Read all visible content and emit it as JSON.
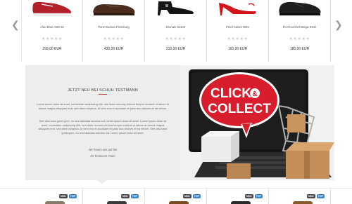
{
  "carousel": {
    "prev_icon": "chevron-left-icon",
    "next_icon": "chevron-right-icon",
    "products": [
      {
        "name": "Aldo Bruè ABS 32",
        "price": "299,00 EUR",
        "stars": "★★★★★",
        "shoe_color": "#b3202a",
        "kind": "sneaker"
      },
      {
        "name": "Panz Bussan Flensburg",
        "price": "430,00 EUR",
        "stars": "★★★★★",
        "shoe_color": "#4a2c1c",
        "kind": "loafer"
      },
      {
        "name": "Brunate 51102",
        "price": "210,00 EUR",
        "stars": "★★★★★",
        "shoe_color": "#141414",
        "kind": "heel-boot"
      },
      {
        "name": "Peter Kaiser Ditte",
        "price": "160,00 EUR",
        "stars": "★★★★★",
        "shoe_color": "#d4141b",
        "kind": "pump"
      },
      {
        "name": "Finn Comfort Braga-Stetz",
        "price": "180,00 EUR",
        "stars": "★★★★★",
        "shoe_color": "#1f1f1f",
        "kind": "derby"
      }
    ]
  },
  "about": {
    "title": "JETZT NEU BEI SCHUH TESTMANN",
    "accent": "#c0392b",
    "paragraph1": "Lorem ipsum dolor sit amet, consetetur sadipscing elitr, sed diam nonumy eirmod tempor invidunt ut labore et dolore magna aliquyam erat, sed diam voluptua. At vero eos et accusam et justo duo dolores et ea rebum.",
    "paragraph2": "Stet clita kasd gubergren, no sea takimata sanctus est Lorem ipsum dolor sit amet. Lorem ipsum dolor sit amet, consetetur sadipscing elitr, sed diam nonumy eirmod tempor invidunt ut labore et dolore magna aliquyam erat, sed diam voluptua. At vero eos et accusam et justo duo dolores et ea rebum. Stet clita kasd gubergren, no sea takimata sanctus est Lorem ipsum dolor sit amet.",
    "signature1": "Wir freuen uns auf Sie",
    "signature2": "Ihr Testmann-Team"
  },
  "promo": {
    "line1": "CLICK",
    "amp": "&",
    "line2": "COLLECT",
    "sign_color": "#d81e2c"
  },
  "bottom": {
    "badge_new": "NEU",
    "badge_top": "TOP",
    "items": [
      {
        "peek_color": "#8a7a6a"
      },
      {
        "peek_color": "#3a3a3a"
      },
      {
        "peek_color": "#7a4a20"
      },
      {
        "peek_color": "#2a2a2a"
      },
      {
        "peek_color": "#8b5a2b"
      }
    ]
  }
}
